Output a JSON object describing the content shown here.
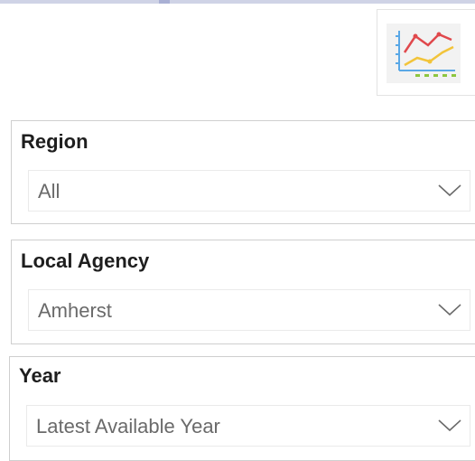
{
  "chart_button": {
    "icon": "line-chart-icon",
    "colors": {
      "axis": "#5aa8e6",
      "series_red": "#e0484c",
      "series_yellow": "#f2c43a",
      "ticks": "#8dc63f",
      "background": "#f2f2f2"
    }
  },
  "slicers": {
    "region": {
      "title": "Region",
      "selected": "All",
      "icon": "chevron-down-icon"
    },
    "local_agency": {
      "title": "Local Agency",
      "selected": "Amherst",
      "icon": "chevron-down-icon"
    },
    "year": {
      "title": "Year",
      "selected": "Latest Available Year",
      "icon": "chevron-down-icon"
    }
  }
}
